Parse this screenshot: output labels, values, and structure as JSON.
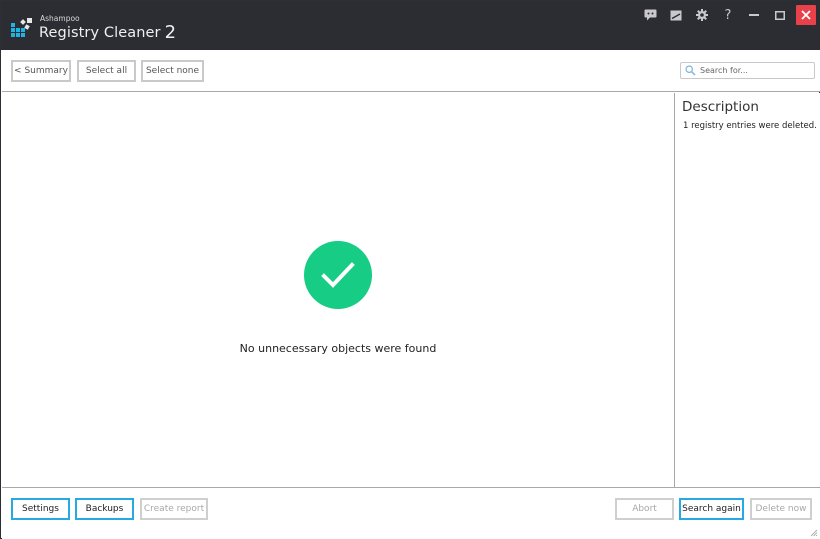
{
  "app": {
    "brand_small": "Ashampoo",
    "title": "Registry Cleaner",
    "version": "2"
  },
  "titlebar": {
    "icons": [
      {
        "name": "feedback-icon",
        "tooltip": ""
      },
      {
        "name": "notes-icon",
        "tooltip": ""
      },
      {
        "name": "gear-icon",
        "tooltip": ""
      },
      {
        "name": "help-icon",
        "glyph": "?"
      },
      {
        "name": "minimize-icon"
      },
      {
        "name": "maximize-icon"
      },
      {
        "name": "close-icon"
      }
    ],
    "help_glyph": "?"
  },
  "toolbar": {
    "summary_label": "< Summary",
    "select_all_label": "Select all",
    "select_none_label": "Select none",
    "search_placeholder": "Search for...",
    "search_value": ""
  },
  "main": {
    "status_icon": "check-circle-icon",
    "status_color": "#17cc85",
    "message": "No unnecessary objects were found"
  },
  "description": {
    "title": "Description",
    "text": "1 registry entries were deleted."
  },
  "footer": {
    "settings_label": "Settings",
    "backups_label": "Backups",
    "create_report_label": "Create report",
    "abort_label": "Abort",
    "search_again_label": "Search again",
    "delete_now_label": "Delete now"
  },
  "colors": {
    "titlebar_bg": "#2b2d33",
    "accent": "#27a9e1",
    "success": "#17cc85",
    "close": "#e8414a"
  }
}
